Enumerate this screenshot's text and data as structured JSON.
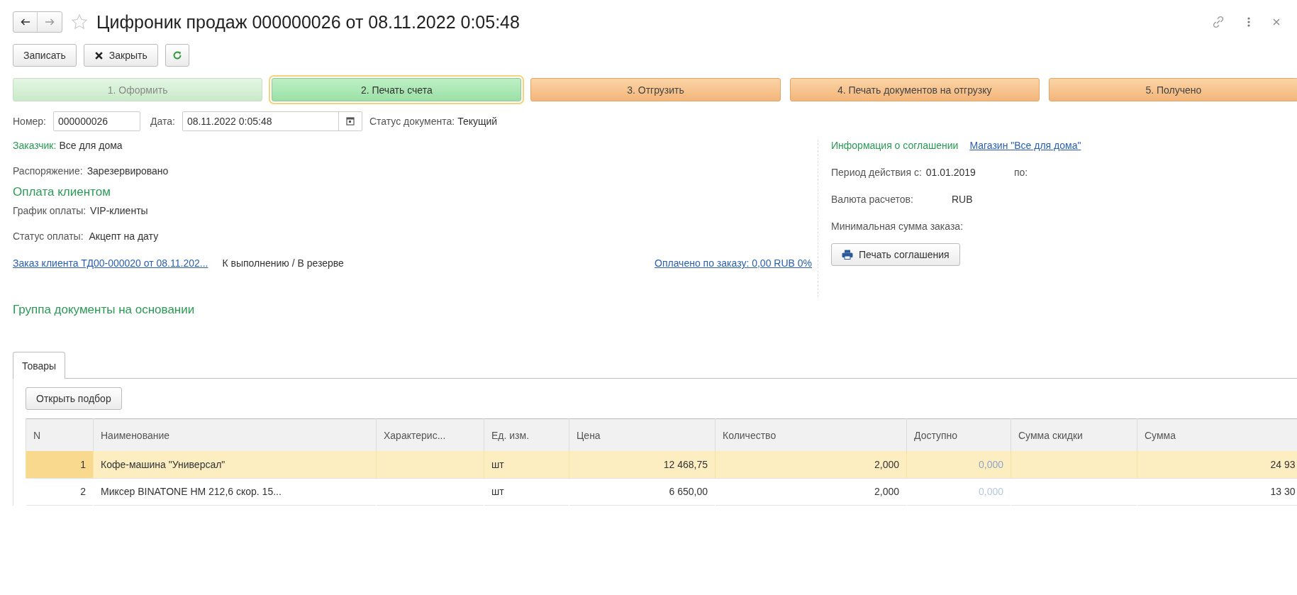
{
  "window": {
    "title": "Цифроник продаж 000000026 от 08.11.2022 0:05:48",
    "favorite": false
  },
  "toolbar": {
    "buttons": [
      {
        "kind": "text",
        "label": "Записать"
      },
      {
        "kind": "close",
        "label": "Закрыть"
      },
      {
        "kind": "refresh"
      }
    ]
  },
  "steps": [
    {
      "label": "1. Оформить",
      "kind": "done"
    },
    {
      "label": "2. Печать счета",
      "kind": "current"
    },
    {
      "label": "3. Отгрузить",
      "kind": "pending"
    },
    {
      "label": "4. Печать документов на отгрузку",
      "kind": "pending"
    },
    {
      "label": "5. Получено",
      "kind": "pending"
    }
  ],
  "header_fields": {
    "number_label": "Номер:",
    "number": "000000026",
    "date_label": "Дата:",
    "date": "08.11.2022  0:05:48",
    "status_label": "Статус документа:",
    "status": "Текущий"
  },
  "customer": {
    "label": "Заказчик:",
    "value": "Все для дома"
  },
  "disposition": {
    "label": "Распоряжение:",
    "value": "Зарезервировано"
  },
  "payment": {
    "title": "Оплата клиентом",
    "schedule_label": "График оплаты:",
    "schedule": "VIP-клиенты",
    "status_label": "Статус оплаты:",
    "status": "Акцепт на дату"
  },
  "order": {
    "link": "Заказ клиента ТД00-000020 от 08.11.202...",
    "state": "К выполнению / В резерве",
    "paid_link": "Оплачено по заказу: 0,00 RUB 0%"
  },
  "agreement": {
    "title": "Информация о соглашении",
    "link": "Магазин \"Все для дома\"",
    "period_label": "Период действия с:",
    "period_from": "01.01.2019",
    "period_to_label": "по:",
    "currency_label": "Валюта расчетов:",
    "currency": "RUB",
    "min_label": "Минимальная сумма заказа:",
    "print_button": "Печать соглашения"
  },
  "group_title": "Группа документы на основании",
  "tabs": [
    {
      "label": "Товары",
      "selected": true
    }
  ],
  "pick_button": "Открыть подбор",
  "table": {
    "columns": [
      "N",
      "Наименование",
      "Характерис...",
      "Ед. изм.",
      "Цена",
      "Количество",
      "Доступно",
      "Сумма скидки",
      "Сумма"
    ],
    "rows": [
      {
        "selected": true,
        "cells": [
          "1",
          "Кофе-машина \"Универсал\"",
          "",
          "шт",
          "12 468,75",
          "2,000",
          "0,000",
          "",
          "24 93"
        ]
      },
      {
        "selected": false,
        "cells": [
          "2",
          "Миксер BINATONE HM 212,6 скор. 15...",
          "",
          "шт",
          "6 650,00",
          "2,000",
          "0,000",
          "",
          "13 30"
        ]
      }
    ]
  }
}
